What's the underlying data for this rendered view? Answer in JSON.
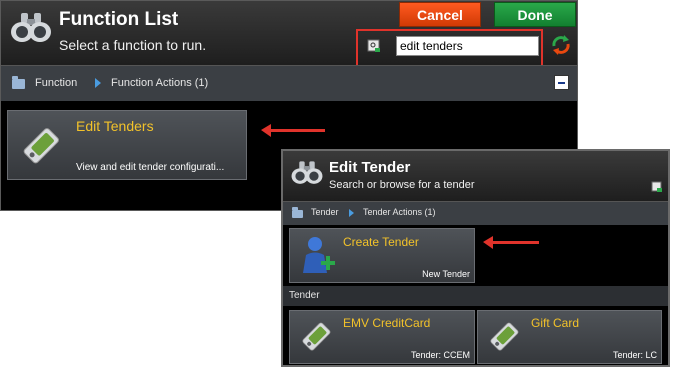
{
  "function_list": {
    "title": "Function List",
    "subtitle": "Select a function to run.",
    "cancel_label": "Cancel",
    "done_label": "Done",
    "search_value": "edit tenders",
    "breadcrumb": [
      "Function",
      "Function Actions (1)"
    ],
    "tiles": [
      {
        "title": "Edit Tenders",
        "description": "View and edit tender configurati..."
      }
    ]
  },
  "edit_tender": {
    "title": "Edit Tender",
    "subtitle": "Search or browse for a tender",
    "breadcrumb": [
      "Tender",
      "Tender Actions (1)"
    ],
    "action_tile": {
      "title": "Create Tender",
      "description": "New Tender"
    },
    "section_label": "Tender",
    "tender_tiles": [
      {
        "title": "EMV CreditCard",
        "description": "Tender: CCEM"
      },
      {
        "title": "Gift Card",
        "description": "Tender: LC"
      }
    ]
  },
  "colors": {
    "accent_gold": "#f2c22a",
    "cancel": "#e8480f",
    "done": "#1f9a3e",
    "highlight": "#e0332b"
  },
  "icons": [
    "binoculars-icon",
    "search-refresh-icon",
    "folder-icon",
    "breadcrumb-arrow-icon",
    "collapse-icon",
    "tag-icon",
    "add-user-icon",
    "new-item-icon"
  ]
}
